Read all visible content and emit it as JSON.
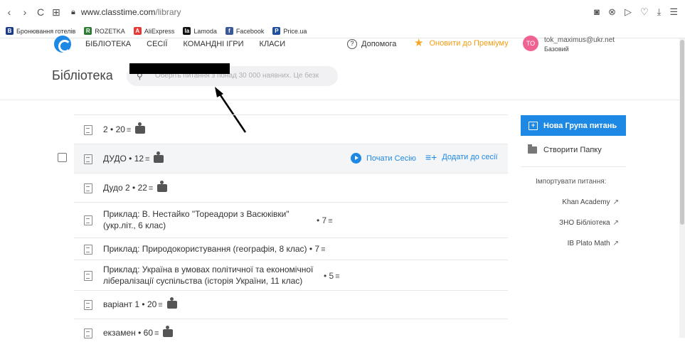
{
  "browser": {
    "back": "‹",
    "forward": "›",
    "reload": "C",
    "tabs_icon": "⊞",
    "url_host": "www.classtime.com",
    "url_path": "/library",
    "right_icons": [
      "camera-icon",
      "block-icon",
      "send-icon",
      "heart-icon",
      "download-icon",
      "menu-icon"
    ]
  },
  "bookmarks": [
    {
      "label": "Бронювання готелів",
      "icon": "B",
      "color": "#1a3a8a"
    },
    {
      "label": "ROZETKA",
      "icon": "R",
      "color": "#2e7d32"
    },
    {
      "label": "AliExpress",
      "icon": "A",
      "color": "#e53935"
    },
    {
      "label": "Lamoda",
      "icon": "la",
      "color": "#111111"
    },
    {
      "label": "Facebook",
      "icon": "f",
      "color": "#3b5998"
    },
    {
      "label": "Price.ua",
      "icon": "P",
      "color": "#1e4fa0"
    }
  ],
  "header": {
    "nav": [
      "БІБЛІОТЕКА",
      "СЕСІЇ",
      "КОМАНДНІ ІГРИ",
      "КЛАСИ"
    ],
    "help_label": "Допомога",
    "premium_label": "Оновити до Преміуму",
    "avatar_initials": "TO",
    "user_email": "tok_maximus@ukr.net",
    "user_plan": "Базовий"
  },
  "page": {
    "title": "Бібліотека",
    "search_placeholder": "Оберіть питання з понад 30 000 наявних. Це безк"
  },
  "rows": [
    {
      "title": "2",
      "count": "20"
    },
    {
      "title": "ДУДО",
      "count": "12",
      "start_session": "Почати Сесію",
      "add_to_session": "Додати до сесії"
    },
    {
      "title": "Дудо 2",
      "count": "22"
    },
    {
      "title_line1": "Приклад: В. Нестайко \"Тореадори з Васюківки\"",
      "title_line2": "(укр.літ., 6 клас)",
      "count": "7"
    },
    {
      "title": "Приклад: Природокористування (географія, 8 клас)",
      "count": "7"
    },
    {
      "title_line1": "Приклад: Україна в умовах політичної та економічної",
      "title_line2": "лібералізації суспільства (історія України, 11 клас)",
      "count": "5"
    },
    {
      "title": "варіант 1",
      "count": "20"
    },
    {
      "title": "екзамен",
      "count": "60"
    }
  ],
  "sidebar": {
    "new_group": "Нова Група питань",
    "create_folder": "Створити Папку",
    "import_heading": "Імпортувати питання:",
    "imports": [
      "Khan Academy",
      "ЗНО Бібліотека",
      "IB Plato Math"
    ]
  }
}
